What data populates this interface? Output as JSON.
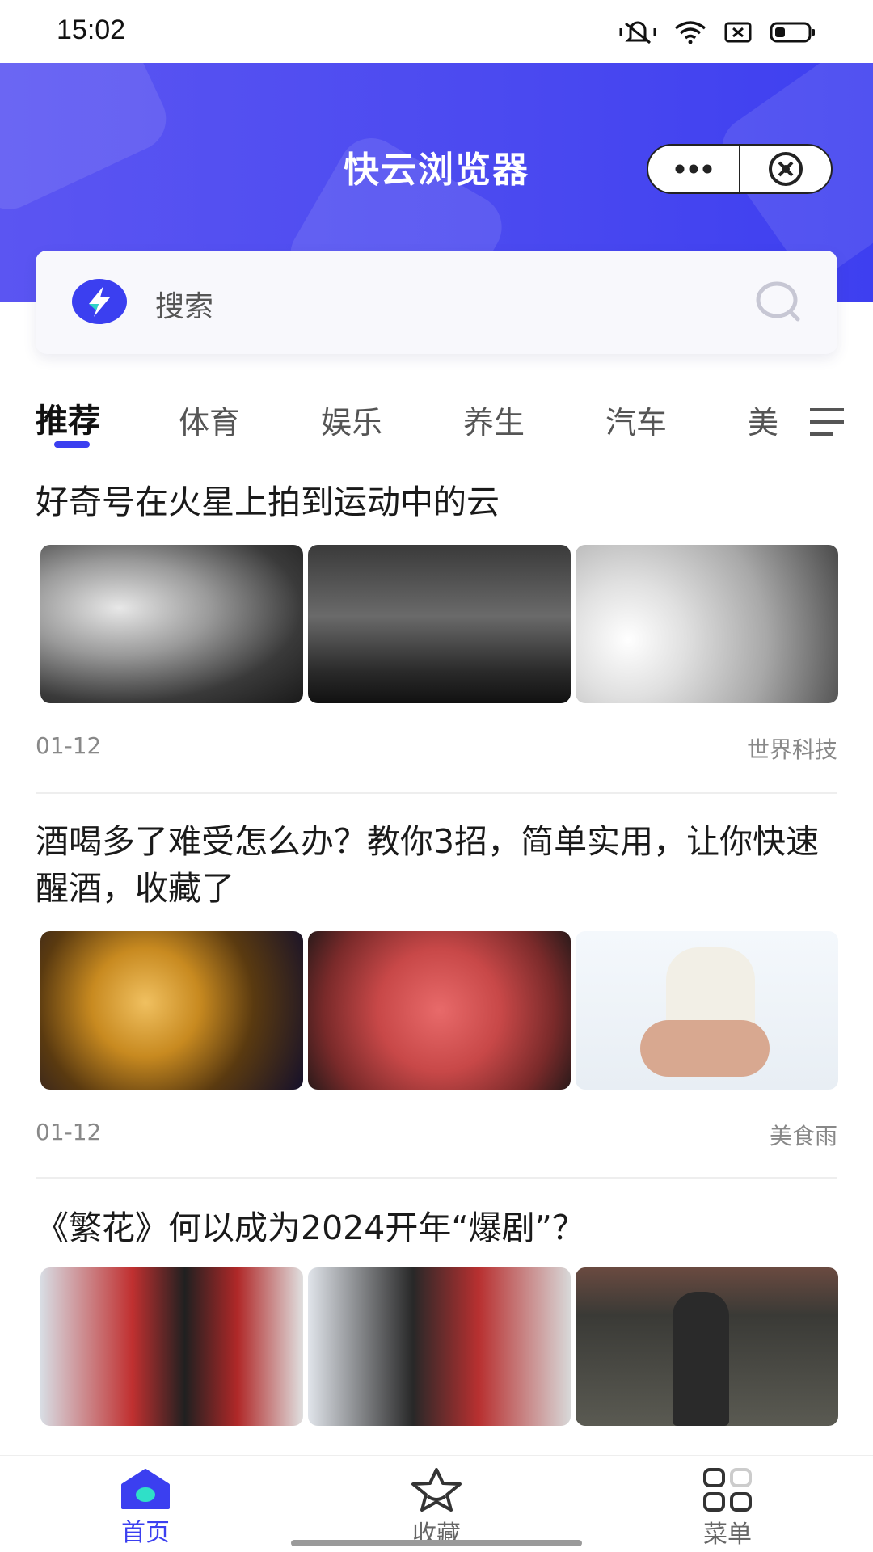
{
  "status_bar": {
    "time": "15:02",
    "icons": [
      "mute-icon",
      "wifi-icon",
      "sim-icon",
      "battery-icon"
    ]
  },
  "header": {
    "title": "快云浏览器",
    "capsule": {
      "more_icon": "ellipsis-icon",
      "close_icon": "close-circle-icon"
    },
    "accent_color": "#4a49f0"
  },
  "search": {
    "placeholder": "搜索"
  },
  "tabs": {
    "items": [
      "推荐",
      "体育",
      "娱乐",
      "养生",
      "汽车",
      "美"
    ],
    "active_index": 0,
    "menu_icon": "list-menu-icon"
  },
  "articles": [
    {
      "title": "好奇号在火星上拍到运动中的云",
      "date": "01-12",
      "source": "世界科技"
    },
    {
      "title": "酒喝多了难受怎么办？教你3招，简单实用，让你快速醒酒，收藏了",
      "date": "01-12",
      "source": "美食雨"
    },
    {
      "title": "《繁花》何以成为2024开年“爆剧”？"
    }
  ],
  "bottom_nav": {
    "items": [
      {
        "label": "首页",
        "icon": "home-icon",
        "active": true
      },
      {
        "label": "收藏",
        "icon": "star-icon",
        "active": false
      },
      {
        "label": "菜单",
        "icon": "grid-icon",
        "active": false
      }
    ]
  }
}
